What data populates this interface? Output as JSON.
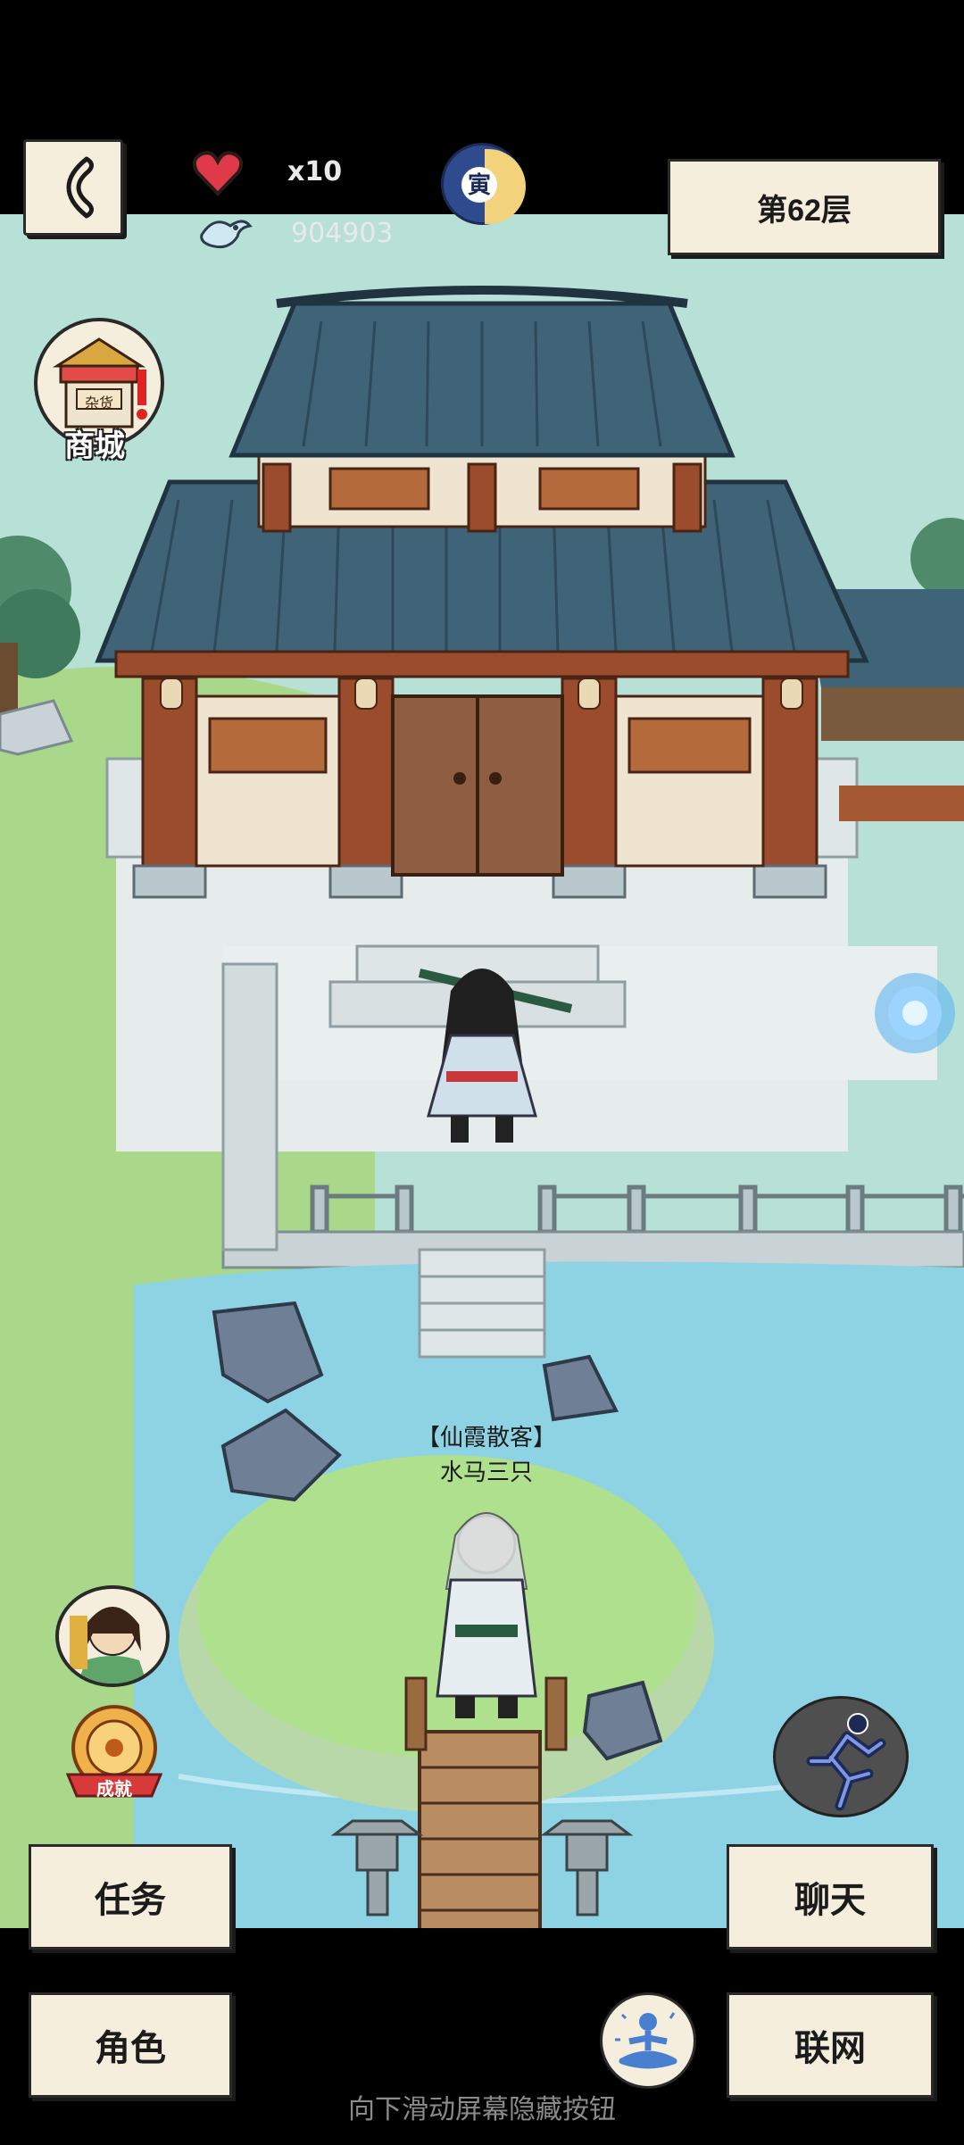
{
  "hud": {
    "lives_count": "x10",
    "currency_amount": "904903",
    "floor_label": "第62层",
    "night_badge_glyph": "寅"
  },
  "left_icons": {
    "shop_label": "商城",
    "shop_sign": "杂货",
    "achievement_label": "成就"
  },
  "npc": {
    "title": "【仙霞散客】",
    "name": "水马三只"
  },
  "buttons": {
    "tasks": "任务",
    "chat": "聊天",
    "character": "角色",
    "online": "联网"
  },
  "footer_hint": "向下滑动屏幕隐藏按钮",
  "colors": {
    "paper": "#f5eedd",
    "roof": "#3f6478",
    "pillar": "#9a4c2c",
    "water": "#8ed3e4",
    "grass": "#9bd07a"
  }
}
